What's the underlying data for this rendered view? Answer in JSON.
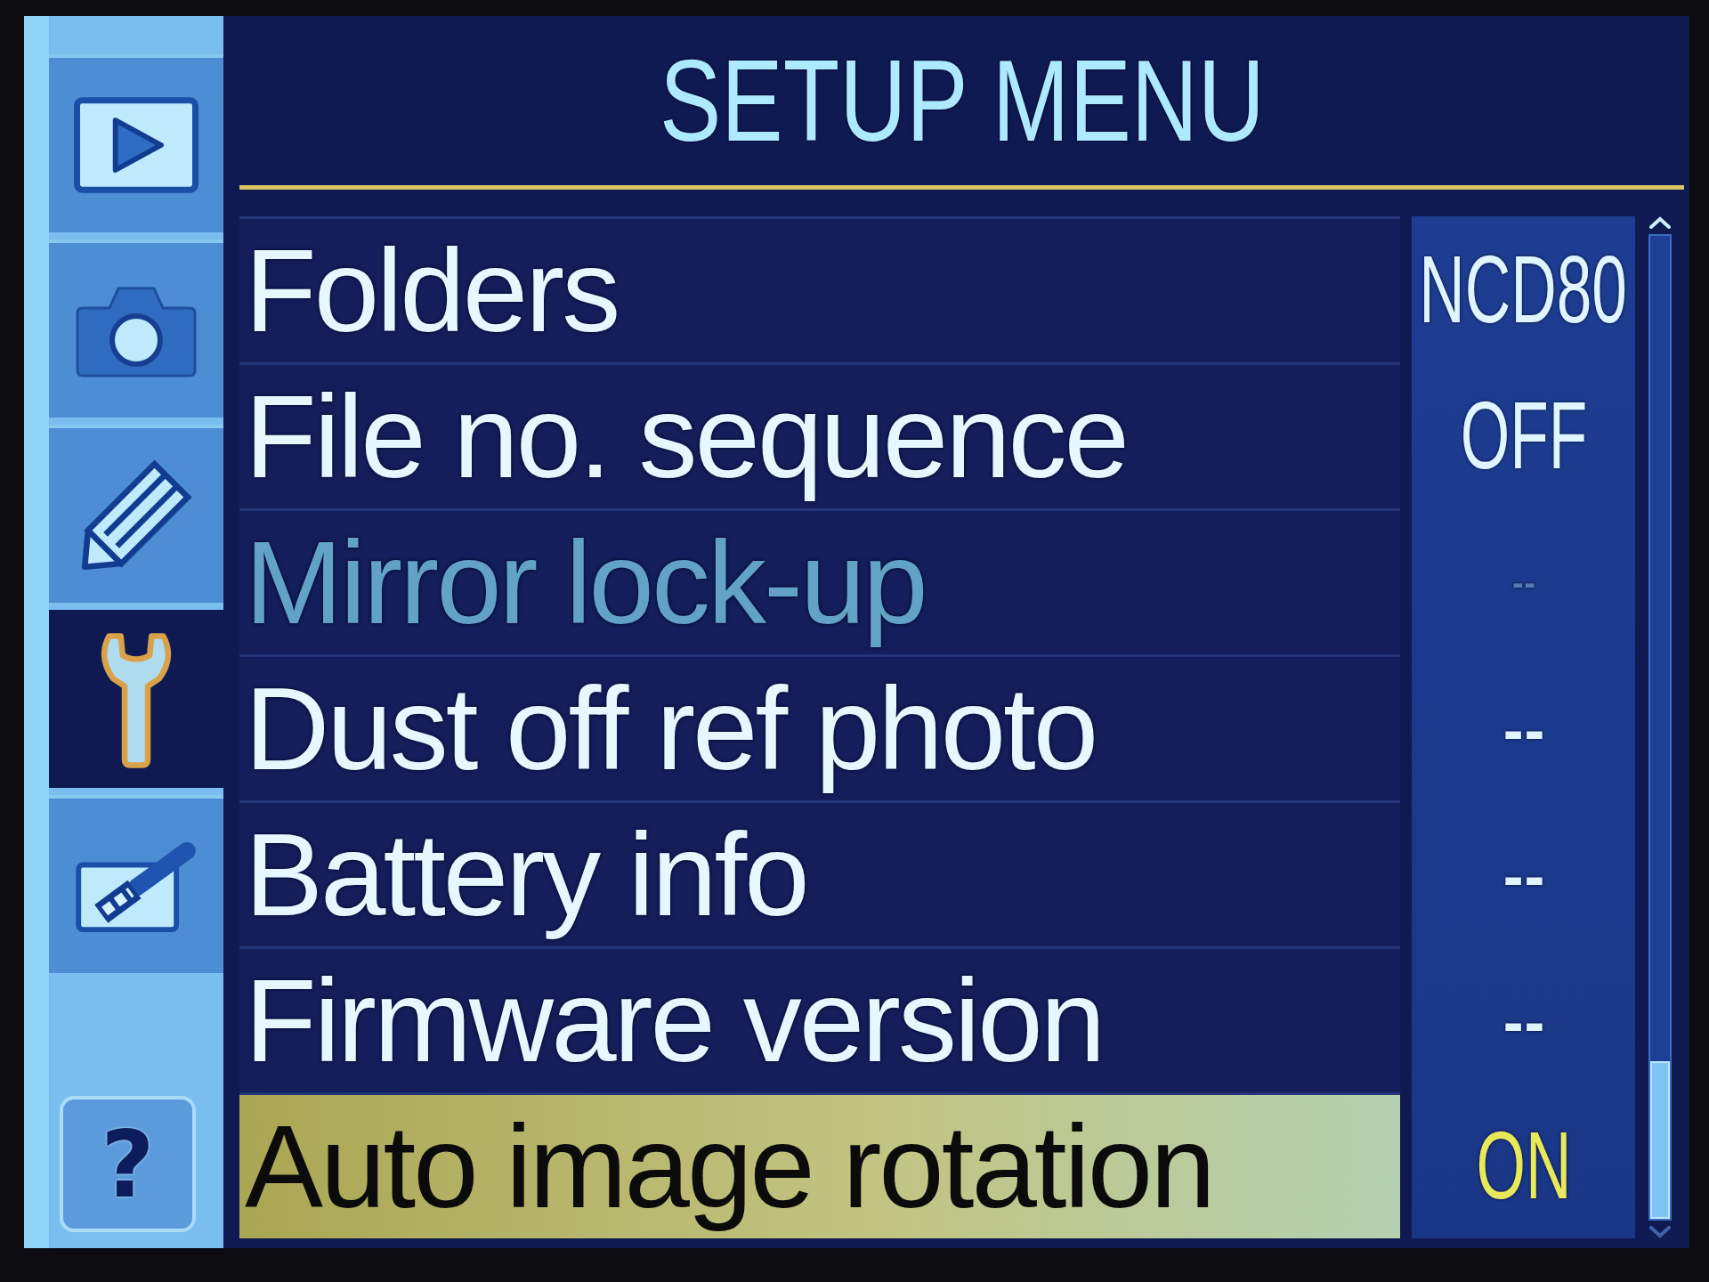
{
  "sidebar": {
    "tabs": [
      {
        "kind": "playback",
        "selected": false
      },
      {
        "kind": "shooting",
        "selected": false
      },
      {
        "kind": "custom",
        "selected": false
      },
      {
        "kind": "setup",
        "selected": true
      },
      {
        "kind": "retouch",
        "selected": false
      }
    ],
    "help_button": {
      "label": "?"
    }
  },
  "title": "SETUP MENU",
  "items": [
    {
      "label": "Folders",
      "value": "NCD80",
      "selected": false,
      "disabled": false
    },
    {
      "label": "File no. sequence",
      "value": "OFF",
      "selected": false,
      "disabled": false
    },
    {
      "label": "Mirror lock-up",
      "value": "--",
      "selected": false,
      "disabled": true
    },
    {
      "label": "Dust off ref photo",
      "value": "--",
      "selected": false,
      "disabled": false
    },
    {
      "label": "Battery info",
      "value": "--",
      "selected": false,
      "disabled": false
    },
    {
      "label": "Firmware version",
      "value": "--",
      "selected": false,
      "disabled": false
    },
    {
      "label": "Auto image rotation",
      "value": "ON",
      "selected": true,
      "disabled": false
    }
  ]
}
